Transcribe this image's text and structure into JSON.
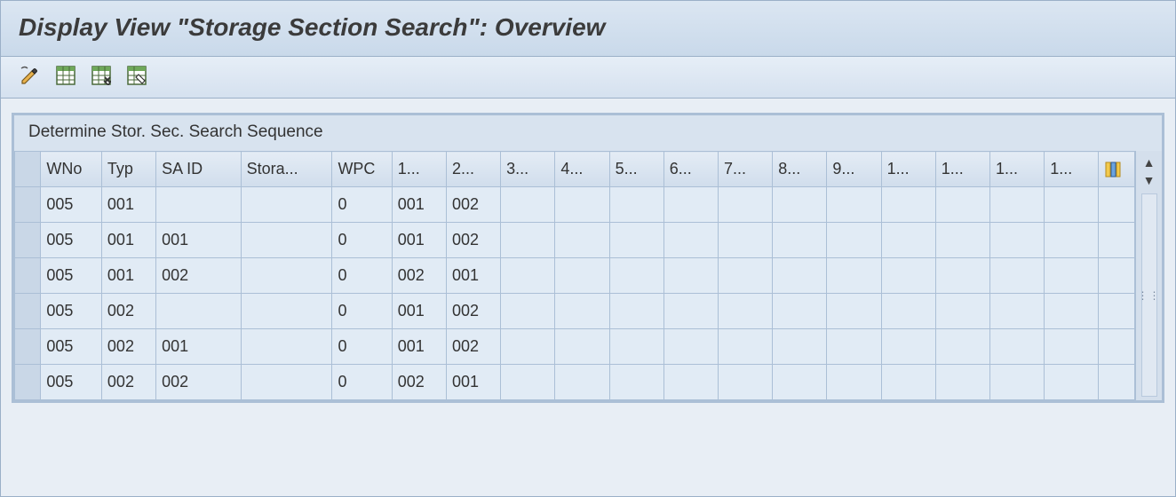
{
  "title": "Display View \"Storage Section Search\": Overview",
  "toolbar": {
    "items": [
      {
        "name": "edit-pencil-icon"
      },
      {
        "name": "table-select-all-icon"
      },
      {
        "name": "table-deselect-icon"
      },
      {
        "name": "table-config-icon"
      }
    ]
  },
  "panel": {
    "title": "Determine Stor. Sec. Search Sequence"
  },
  "grid": {
    "columns": [
      "WNo",
      "Typ",
      "SA ID",
      "Stora...",
      "WPC",
      "1...",
      "2...",
      "3...",
      "4...",
      "5...",
      "6...",
      "7...",
      "8...",
      "9...",
      "1...",
      "1...",
      "1...",
      "1..."
    ],
    "rows": [
      {
        "WNo": "005",
        "Typ": "001",
        "SA ID": "",
        "Stora": "",
        "WPC": "0",
        "c1": "001",
        "c2": "002",
        "c3": "",
        "c4": "",
        "c5": "",
        "c6": "",
        "c7": "",
        "c8": "",
        "c9": "",
        "c10": "",
        "c11": "",
        "c12": "",
        "c13": ""
      },
      {
        "WNo": "005",
        "Typ": "001",
        "SA ID": "001",
        "Stora": "",
        "WPC": "0",
        "c1": "001",
        "c2": "002",
        "c3": "",
        "c4": "",
        "c5": "",
        "c6": "",
        "c7": "",
        "c8": "",
        "c9": "",
        "c10": "",
        "c11": "",
        "c12": "",
        "c13": ""
      },
      {
        "WNo": "005",
        "Typ": "001",
        "SA ID": "002",
        "Stora": "",
        "WPC": "0",
        "c1": "002",
        "c2": "001",
        "c3": "",
        "c4": "",
        "c5": "",
        "c6": "",
        "c7": "",
        "c8": "",
        "c9": "",
        "c10": "",
        "c11": "",
        "c12": "",
        "c13": ""
      },
      {
        "WNo": "005",
        "Typ": "002",
        "SA ID": "",
        "Stora": "",
        "WPC": "0",
        "c1": "001",
        "c2": "002",
        "c3": "",
        "c4": "",
        "c5": "",
        "c6": "",
        "c7": "",
        "c8": "",
        "c9": "",
        "c10": "",
        "c11": "",
        "c12": "",
        "c13": ""
      },
      {
        "WNo": "005",
        "Typ": "002",
        "SA ID": "001",
        "Stora": "",
        "WPC": "0",
        "c1": "001",
        "c2": "002",
        "c3": "",
        "c4": "",
        "c5": "",
        "c6": "",
        "c7": "",
        "c8": "",
        "c9": "",
        "c10": "",
        "c11": "",
        "c12": "",
        "c13": ""
      },
      {
        "WNo": "005",
        "Typ": "002",
        "SA ID": "002",
        "Stora": "",
        "WPC": "0",
        "c1": "002",
        "c2": "001",
        "c3": "",
        "c4": "",
        "c5": "",
        "c6": "",
        "c7": "",
        "c8": "",
        "c9": "",
        "c10": "",
        "c11": "",
        "c12": "",
        "c13": ""
      }
    ]
  },
  "column_widths": {
    "WNo": 56,
    "Typ": 50,
    "SA ID": 78,
    "Stora": 84,
    "WPC": 52,
    "c1": 50,
    "c2": 50,
    "c3": 50,
    "c4": 50,
    "c5": 50,
    "c6": 50,
    "c7": 50,
    "c8": 50,
    "c9": 50,
    "c10": 50,
    "c11": 50,
    "c12": 50,
    "c13": 50
  }
}
